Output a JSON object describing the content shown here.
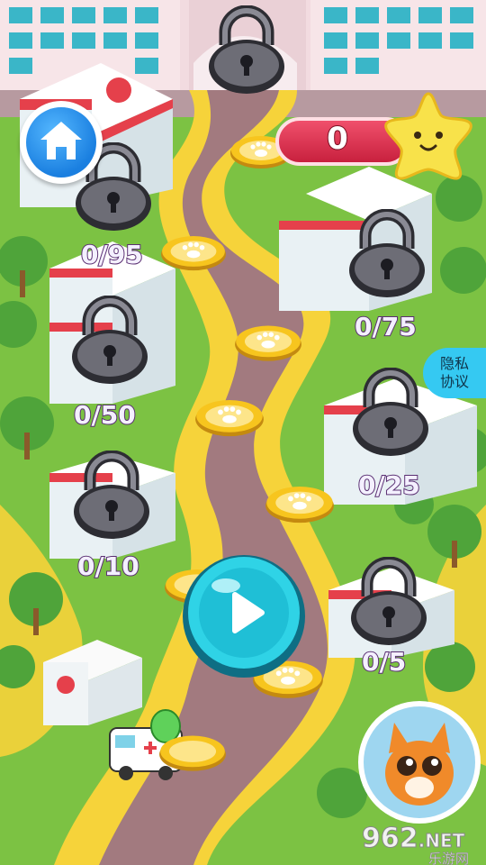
{
  "score": {
    "value": "0",
    "icon": "star-face-icon"
  },
  "nav": {
    "home_icon": "home-icon"
  },
  "privacy": {
    "line1": "隐私",
    "line2": "协议"
  },
  "play": {
    "icon": "play-icon"
  },
  "levels": [
    {
      "progress": "0/95",
      "locked": true
    },
    {
      "progress": "0/75",
      "locked": true
    },
    {
      "progress": "0/50",
      "locked": true
    },
    {
      "progress": "0/25",
      "locked": true
    },
    {
      "progress": "0/10",
      "locked": true
    },
    {
      "progress": "0/5",
      "locked": true
    }
  ],
  "watermark": {
    "brand": "962",
    "suffix": ".NET",
    "tagline": "乐游网"
  },
  "colors": {
    "grass": "#7cc243",
    "path": "#a27a7f",
    "path_border": "#f6d33a",
    "coin": "#f7c51e",
    "score_pill": "#e43352",
    "play_button": "#2fd3e6",
    "privacy_bubble": "#35c9f2"
  }
}
